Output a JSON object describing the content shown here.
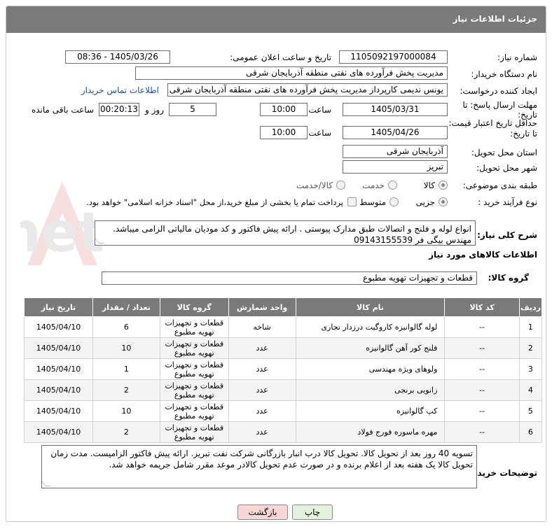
{
  "header": {
    "title": "جزئیات اطلاعات نیاز"
  },
  "fields": {
    "need_number_label": "شماره نیاز:",
    "need_number": "1105092197000084",
    "announce_label": "تاریخ و ساعت اعلان عمومی:",
    "announce_value": "1405/03/26 - 08:36",
    "buyer_org_label": "نام دستگاه خریدار:",
    "buyer_org": "مدیریت پخش فرآورده های نفتی منطقه آذربایجان شرقی",
    "creator_label": "ایجاد کننده درخواست:",
    "creator": "یونس ندیمی کارپرداز مدیریت پخش فرآورده های نفتی منطقه آذربایجان شرقی",
    "contact_link": "اطلاعات تماس خریدار",
    "reply_deadline_label_1": "مهلت ارسال پاسخ: تا",
    "reply_deadline_label_2": "تاریخ:",
    "reply_date": "1405/03/31",
    "time_label": "ساعت",
    "reply_time": "10:00",
    "days_value": "5",
    "days_label": "روز و",
    "remaining_value": "00:20:13",
    "remaining_label": "ساعت باقی مانده",
    "price_deadline_label_1": "حداقل تاریخ اعتبار قیمت:",
    "price_deadline_label_2": "تا تاریخ:",
    "price_date": "1405/04/26",
    "price_time": "10:00",
    "province_label": "استان محل تحویل:",
    "province": "آذربایجان شرقی",
    "city_label": "شهر محل تحویل:",
    "city": "تبریز",
    "category_label": "طبقه بندی موضوعی:",
    "category_options": [
      "کالا",
      "خدمت",
      "کالا/خدمت"
    ],
    "process_label": "نوع فرآیند خرید :",
    "process_options": [
      "جزیی",
      "متوسط"
    ],
    "payment_note": "پرداخت تمام یا بخشی از مبلغ خرید،از محل \"اسناد خزانه اسلامی\" خواهد بود."
  },
  "description": {
    "label": "شرح کلی نیاز:",
    "text": "انواع لوله و فلنج و اتصالات طبق مدارک پیوستی . ارائه پیش فاکتور و کد مودیان مالیاتی الزامی میباشد. مهندس بیگی فر 09143155539"
  },
  "goods": {
    "section_title": "اطلاعات کالاهای مورد نیاز",
    "group_label": "گروه کالا:",
    "group_value": "قطعات و تجهیزات تهویه مطبوع"
  },
  "table": {
    "headers": [
      "ردیف",
      "کد کالا",
      "نام کالا",
      "واحد شمارش",
      "گروه کالا",
      "تعداد / مقدار",
      "تاریخ نیاز"
    ],
    "rows": [
      {
        "idx": "1",
        "code": "--",
        "name": "لوله گالوانیزه کاروگیت درزدار تجاری",
        "unit": "شاخه",
        "group": "قطعات و تجهیزات تهویه مطبوع",
        "qty": "6",
        "date": "1405/04/10"
      },
      {
        "idx": "2",
        "code": "--",
        "name": "فلنج کور آهن گالوانیزه",
        "unit": "عدد",
        "group": "قطعات و تجهیزات تهویه مطبوع",
        "qty": "10",
        "date": "1405/04/10"
      },
      {
        "idx": "3",
        "code": "--",
        "name": "ولوهای ویژه مهندسی",
        "unit": "عدد",
        "group": "قطعات و تجهیزات تهویه مطبوع",
        "qty": "1",
        "date": "1405/04/10"
      },
      {
        "idx": "4",
        "code": "--",
        "name": "زانویی برنجی",
        "unit": "عدد",
        "group": "قطعات و تجهیزات تهویه مطبوع",
        "qty": "2",
        "date": "1405/04/10"
      },
      {
        "idx": "5",
        "code": "--",
        "name": "کپ گالوانیزه",
        "unit": "عدد",
        "group": "قطعات و تجهیزات تهویه مطبوع",
        "qty": "10",
        "date": "1405/04/10"
      },
      {
        "idx": "6",
        "code": "--",
        "name": "مهره ماسوره فورج فولاد",
        "unit": "عدد",
        "group": "قطعات و تجهیزات تهویه مطبوع",
        "qty": "2",
        "date": "1405/04/10"
      }
    ]
  },
  "buyer_notes": {
    "label": "توضیحات خریدار:",
    "text": "تسویه 40 روز بعد از تحویل کالا. تحویل کالا درب انبار بازرگانی شرکت نفت تبریز. ارائه پیش فاکتور الزامیست. مدت زمان تحویل کالا یک هفته بعد از اعلام برنده و در صورت عدم تحویل کالادر موعد مقرر شامل جریمه خواهد شد."
  },
  "buttons": {
    "print": "چاپ",
    "back": "بازگشت"
  },
  "watermark_text": "AriaTender.net",
  "colors": {
    "header": "#7a7a7a",
    "link": "#1a4fa0",
    "back_button": "#f8d6d6",
    "print_button": "#e2f2dc"
  }
}
